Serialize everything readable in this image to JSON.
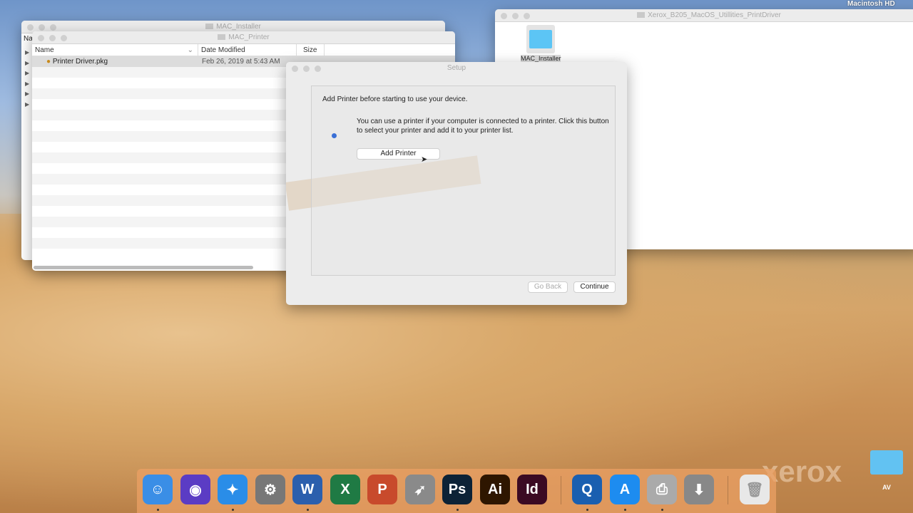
{
  "menubar": {
    "disk_label": "Macintosh HD"
  },
  "win_installer": {
    "title": "MAC_Installer",
    "col_partial": "Na"
  },
  "win_printer": {
    "title": "MAC_Printer",
    "columns": [
      "Name",
      "Date Modified",
      "Size"
    ],
    "rows": [
      {
        "name": "Printer Driver.pkg",
        "date": "Feb 26, 2019 at 5:43 AM"
      }
    ]
  },
  "win_xerox": {
    "title": "Xerox_B205_MacOS_Utillities_PrintDriver",
    "folder_label": "MAC_Installer"
  },
  "setup": {
    "title": "Setup",
    "heading": "Add Printer before starting to use your device.",
    "description": "You can use a printer if your computer is connected to a printer. Click this button to select your printer and add it to your printer list.",
    "add_printer": "Add Printer",
    "go_back": "Go Back",
    "continue": "Continue"
  },
  "desktop": {
    "folder_label": "AV",
    "watermark": "xerox"
  },
  "dock": {
    "items": [
      {
        "name": "finder",
        "glyph": "☺",
        "color": "#3a8ee6"
      },
      {
        "name": "siri",
        "glyph": "◉",
        "color": "#5b3cc4"
      },
      {
        "name": "safari",
        "glyph": "✦",
        "color": "#2a8de8"
      },
      {
        "name": "system-preferences",
        "glyph": "⚙",
        "color": "#777"
      },
      {
        "name": "word",
        "glyph": "W",
        "color": "#2b5fad"
      },
      {
        "name": "excel",
        "glyph": "X",
        "color": "#1f7a44"
      },
      {
        "name": "powerpoint",
        "glyph": "P",
        "color": "#c84a2c"
      },
      {
        "name": "launchpad",
        "glyph": "➶",
        "color": "#8a8a8a"
      },
      {
        "name": "photoshop",
        "glyph": "Ps",
        "color": "#0c2236"
      },
      {
        "name": "illustrator",
        "glyph": "Ai",
        "color": "#2e1600"
      },
      {
        "name": "indesign",
        "glyph": "Id",
        "color": "#3b0a23"
      },
      {
        "name": "quicktime",
        "glyph": "Q",
        "color": "#1a5fb0"
      },
      {
        "name": "app-store",
        "glyph": "A",
        "color": "#1d8cf0"
      },
      {
        "name": "printer",
        "glyph": "⎙",
        "color": "#aaa"
      },
      {
        "name": "downloads",
        "glyph": "⬇",
        "color": "#888"
      },
      {
        "name": "trash",
        "glyph": "🗑",
        "color": "#e8e8e8"
      }
    ]
  }
}
